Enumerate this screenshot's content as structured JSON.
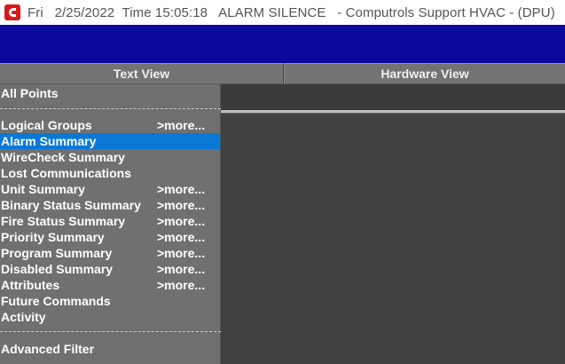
{
  "window": {
    "title": "Fri   2/25/2022  Time 15:05:18   ALARM SILENCE   - Computrols Support HVAC - (DPU)",
    "icon": "computrols-logo-icon",
    "accent": "#0a0a9e"
  },
  "tabs": [
    {
      "label": "Text View"
    },
    {
      "label": "Hardware View"
    }
  ],
  "menu": {
    "all_points": "All Points",
    "separator": "------------------------------------------------------",
    "items": [
      {
        "label": "Logical Groups",
        "more": ">more..."
      },
      {
        "label": "Alarm Summary",
        "more": ""
      },
      {
        "label": "WireCheck Summary",
        "more": ""
      },
      {
        "label": "Lost Communications",
        "more": ""
      },
      {
        "label": "Unit Summary",
        "more": ">more..."
      },
      {
        "label": "Binary Status Summary",
        "more": ">more..."
      },
      {
        "label": "Fire Status Summary",
        "more": ">more..."
      },
      {
        "label": "Priority Summary",
        "more": ">more..."
      },
      {
        "label": "Program Summary",
        "more": ">more..."
      },
      {
        "label": "Disabled Summary",
        "more": ">more..."
      },
      {
        "label": "Attributes",
        "more": ">more..."
      },
      {
        "label": "Future Commands",
        "more": ""
      },
      {
        "label": "Activity",
        "more": ""
      }
    ],
    "selected": "Alarm Summary",
    "advanced_filter": "Advanced Filter",
    "selection_color": "#0a78d7"
  }
}
